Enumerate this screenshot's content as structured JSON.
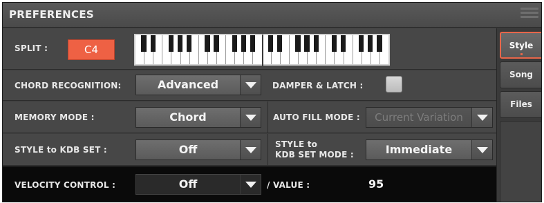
{
  "window": {
    "title": "PREFERENCES",
    "menu_icon": "hamburger-menu-icon"
  },
  "split": {
    "label": "SPLIT :",
    "value": "C4",
    "keyboard": "keyboard-split-icon"
  },
  "chord_recognition": {
    "label": "CHORD RECOGNITION:",
    "value": "Advanced"
  },
  "damper_latch": {
    "label": "DAMPER & LATCH :",
    "checked": false
  },
  "memory_mode": {
    "label": "MEMORY MODE :",
    "value": "Chord"
  },
  "auto_fill_mode": {
    "label": "AUTO FILL MODE :",
    "value": "Current Variation",
    "enabled": false
  },
  "style_kdb_set": {
    "label": "STYLE to KDB SET :",
    "value": "Off"
  },
  "style_kdb_set_mode": {
    "label_line1": "STYLE to",
    "label_line2": "KDB SET MODE :",
    "value": "Immediate"
  },
  "velocity_control": {
    "label": "VELOCITY CONTROL :",
    "value": "Off",
    "value_label": "/  VALUE :",
    "value_number": "95"
  },
  "tabs": [
    {
      "label": "Style",
      "active": true
    },
    {
      "label": "Song",
      "active": false
    },
    {
      "label": "Files",
      "active": false
    }
  ],
  "colors": {
    "accent": "#ee6144",
    "panel": "#474747",
    "highlight_row": "#0a0a0a"
  }
}
